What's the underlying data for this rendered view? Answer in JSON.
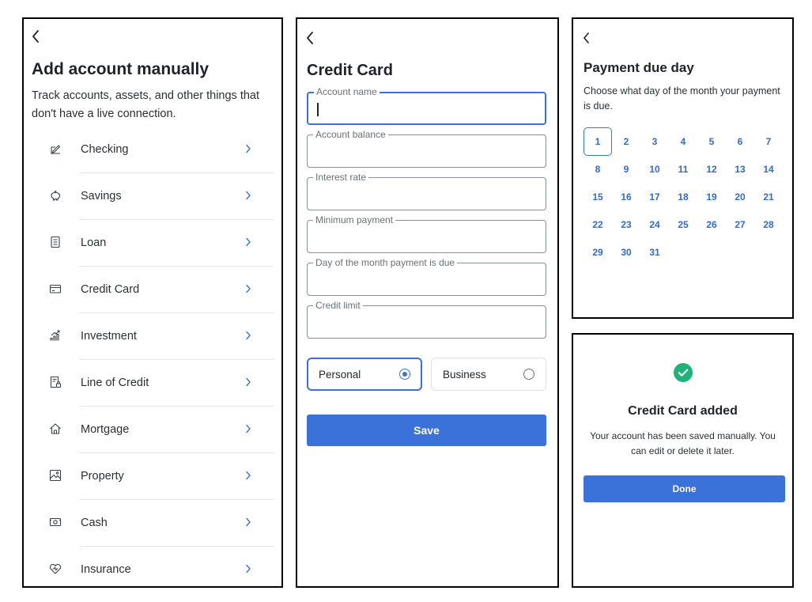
{
  "add_account": {
    "back_icon": "chevron-left-icon",
    "title": "Add account manually",
    "subtitle": "Track accounts, assets, and other things that don't have a live connection.",
    "items": [
      {
        "label": "Checking",
        "icon": "document-edit-icon"
      },
      {
        "label": "Savings",
        "icon": "piggy-bank-icon"
      },
      {
        "label": "Loan",
        "icon": "document-icon"
      },
      {
        "label": "Credit Card",
        "icon": "credit-card-icon"
      },
      {
        "label": "Investment",
        "icon": "growth-chart-icon"
      },
      {
        "label": "Line of Credit",
        "icon": "document-lock-icon"
      },
      {
        "label": "Mortgage",
        "icon": "home-icon"
      },
      {
        "label": "Property",
        "icon": "image-icon"
      },
      {
        "label": "Cash",
        "icon": "cash-icon"
      },
      {
        "label": "Insurance",
        "icon": "heart-shield-icon"
      }
    ]
  },
  "credit_card_form": {
    "back_icon": "chevron-left-icon",
    "title": "Credit Card",
    "fields": [
      {
        "label": "Account name",
        "value": ""
      },
      {
        "label": "Account balance",
        "value": ""
      },
      {
        "label": "Interest rate",
        "value": ""
      },
      {
        "label": "Minimum payment",
        "value": ""
      },
      {
        "label": "Day of the month payment is due",
        "value": ""
      },
      {
        "label": "Credit limit",
        "value": ""
      }
    ],
    "account_type": {
      "options": [
        "Personal",
        "Business"
      ],
      "selected": "Personal"
    },
    "save_label": "Save"
  },
  "payment_due_day": {
    "back_icon": "chevron-left-icon",
    "title": "Payment due day",
    "subtitle": "Choose what day of the month your payment is due.",
    "days": [
      "1",
      "2",
      "3",
      "4",
      "5",
      "6",
      "7",
      "8",
      "9",
      "10",
      "11",
      "12",
      "13",
      "14",
      "15",
      "16",
      "17",
      "18",
      "19",
      "20",
      "21",
      "22",
      "23",
      "24",
      "25",
      "26",
      "27",
      "28",
      "29",
      "30",
      "31"
    ],
    "selected_day": "1"
  },
  "confirmation": {
    "icon": "check-circle-icon",
    "title": "Credit Card added",
    "message": "Your account has been saved manually. You can edit or delete it later.",
    "done_label": "Done"
  },
  "colors": {
    "accent": "#3a72d9",
    "success": "#1fb37a",
    "text": "#1f2328",
    "panel_border": "#000000"
  }
}
